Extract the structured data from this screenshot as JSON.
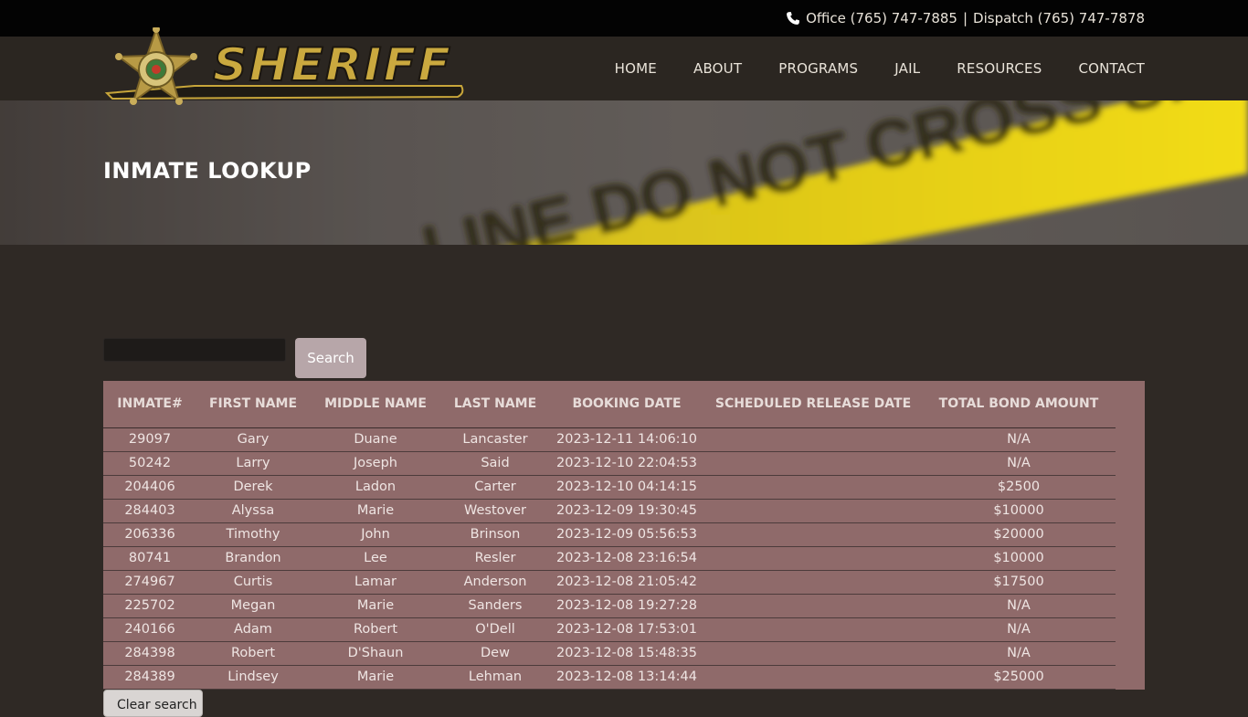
{
  "topbar": {
    "office": "Office (765) 747-7885",
    "separator": "|",
    "dispatch": "Dispatch (765) 747-7878",
    "icon": "phone-icon"
  },
  "logo": {
    "text": "SHERIFF",
    "icon": "sheriff-star-badge"
  },
  "nav": [
    {
      "label": "HOME"
    },
    {
      "label": "ABOUT"
    },
    {
      "label": "PROGRAMS"
    },
    {
      "label": "JAIL"
    },
    {
      "label": "RESOURCES"
    },
    {
      "label": "CONTACT"
    }
  ],
  "banner": {
    "title": "INMATE LOOKUP",
    "tape_text": "LINE DO NOT CROSS  SHERIFF LINE D"
  },
  "search": {
    "value": "",
    "button_label": "Search"
  },
  "table": {
    "columns": [
      "INMATE#",
      "FIRST NAME",
      "MIDDLE NAME",
      "LAST NAME",
      "BOOKING DATE",
      "SCHEDULED RELEASE DATE",
      "TOTAL BOND AMOUNT"
    ],
    "rows": [
      [
        "29097",
        "Gary",
        "Duane",
        "Lancaster",
        "2023-12-11 14:06:10",
        "",
        "N/A"
      ],
      [
        "50242",
        "Larry",
        "Joseph",
        "Said",
        "2023-12-10 22:04:53",
        "",
        "N/A"
      ],
      [
        "204406",
        "Derek",
        "Ladon",
        "Carter",
        "2023-12-10 04:14:15",
        "",
        "$2500"
      ],
      [
        "284403",
        "Alyssa",
        "Marie",
        "Westover",
        "2023-12-09 19:30:45",
        "",
        "$10000"
      ],
      [
        "206336",
        "Timothy",
        "John",
        "Brinson",
        "2023-12-09 05:56:53",
        "",
        "$20000"
      ],
      [
        "80741",
        "Brandon",
        "Lee",
        "Resler",
        "2023-12-08 23:16:54",
        "",
        "$10000"
      ],
      [
        "274967",
        "Curtis",
        "Lamar",
        "Anderson",
        "2023-12-08 21:05:42",
        "",
        "$17500"
      ],
      [
        "225702",
        "Megan",
        "Marie",
        "Sanders",
        "2023-12-08 19:27:28",
        "",
        "N/A"
      ],
      [
        "240166",
        "Adam",
        "Robert",
        "O'Dell",
        "2023-12-08 17:53:01",
        "",
        "N/A"
      ],
      [
        "284398",
        "Robert",
        "D'Shaun",
        "Dew",
        "2023-12-08 15:48:35",
        "",
        "N/A"
      ],
      [
        "284389",
        "Lindsey",
        "Marie",
        "Lehman",
        "2023-12-08 13:14:44",
        "",
        "$25000"
      ]
    ]
  },
  "clear_button": {
    "label": "Clear search"
  },
  "colors": {
    "topbar": "#030303",
    "header": "#2b2621",
    "page": "#2f2925",
    "table": "#8f6a6a",
    "search_button": "#b7a6a9",
    "logo_gold": "#c8a63a",
    "tape_yellow": "#e6cf14"
  }
}
